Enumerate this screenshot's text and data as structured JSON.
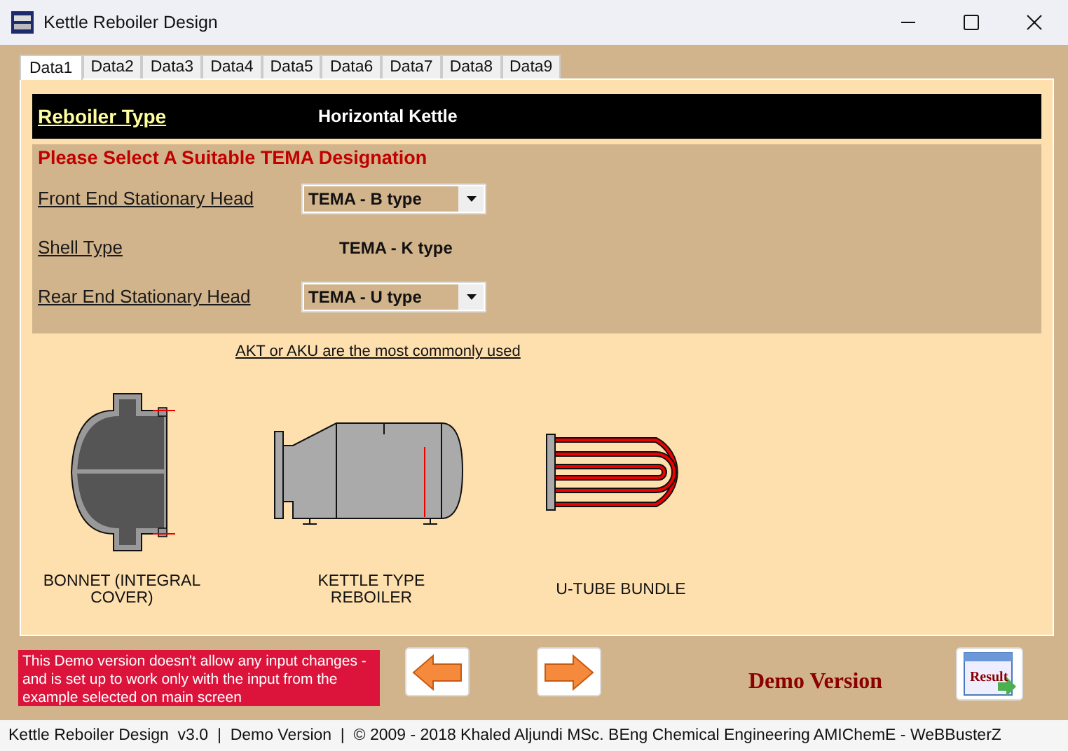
{
  "window": {
    "title": "Kettle Reboiler Design"
  },
  "tabs": [
    {
      "label": "Data1",
      "selected": true
    },
    {
      "label": "Data2",
      "selected": false
    },
    {
      "label": "Data3",
      "selected": false
    },
    {
      "label": "Data4",
      "selected": false
    },
    {
      "label": "Data5",
      "selected": false
    },
    {
      "label": "Data6",
      "selected": false
    },
    {
      "label": "Data7",
      "selected": false
    },
    {
      "label": "Data8",
      "selected": false
    },
    {
      "label": "Data9",
      "selected": false
    }
  ],
  "reboiler_type": {
    "label": "Reboiler Type",
    "value": "Horizontal Kettle"
  },
  "tema": {
    "heading": "Please Select A Suitable TEMA Designation",
    "fields": [
      {
        "kind": "dropdown",
        "label": "Front End Stationary Head",
        "value": "TEMA - B type"
      },
      {
        "kind": "static",
        "label": "Shell Type",
        "value": "TEMA - K type"
      },
      {
        "kind": "dropdown",
        "label": "Rear End Stationary Head",
        "value": "TEMA - U type"
      }
    ]
  },
  "note": "AKT or AKU are the most commonly used",
  "figures": [
    {
      "kind": "bonnet",
      "caption": "BONNET (INTEGRAL COVER)"
    },
    {
      "kind": "kettle",
      "caption": "KETTLE TYPE REBOILER"
    },
    {
      "kind": "utube",
      "caption": "U-TUBE BUNDLE"
    }
  ],
  "demo_notice": "This Demo version doesn't allow any input changes - and is set up to work only with the input from the example selected on main screen",
  "demo_label": "Demo Version",
  "result_button": "Result",
  "status_bar": "Kettle Reboiler Design  v3.0  |  Demo Version  |  © 2009 - 2018 Khaled Aljundi MSc. BEng Chemical Engineering AMIChemE - WeBBusterZ"
}
